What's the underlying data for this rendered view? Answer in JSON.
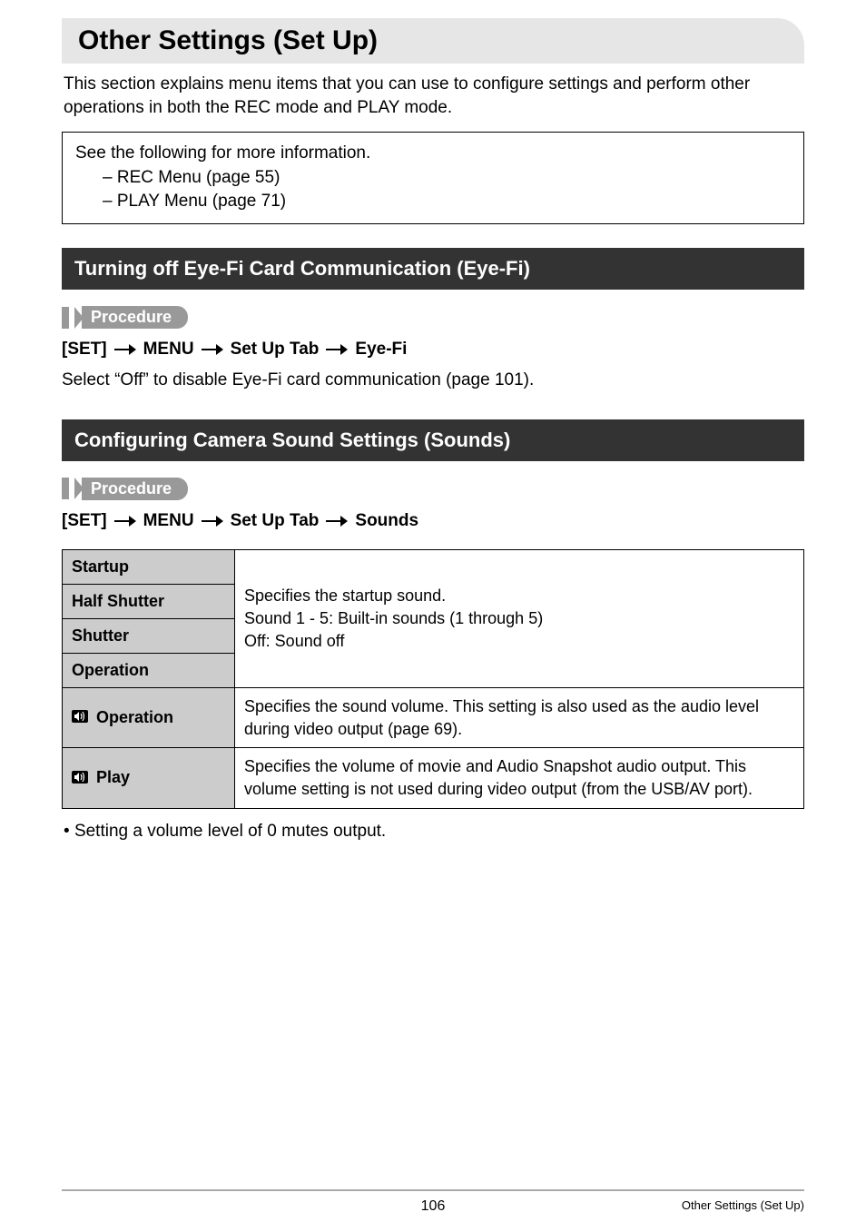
{
  "page_title": "Other Settings (Set Up)",
  "intro": "This section explains menu items that you can use to configure settings and perform other operations in both the REC mode and PLAY mode.",
  "info_box": {
    "lead": "See the following for more information.",
    "items": [
      "REC Menu (page 55)",
      "PLAY Menu (page 71)"
    ]
  },
  "sections": [
    {
      "heading": "Turning off Eye-Fi Card Communication (Eye-Fi)",
      "procedure_label": "Procedure",
      "breadcrumb": [
        "[SET]",
        "MENU",
        "Set Up Tab",
        "Eye-Fi"
      ],
      "body": "Select “Off” to disable Eye-Fi card communication (page 101)."
    },
    {
      "heading": "Configuring Camera Sound Settings (Sounds)",
      "procedure_label": "Procedure",
      "breadcrumb": [
        "[SET]",
        "MENU",
        "Set Up Tab",
        "Sounds"
      ]
    }
  ],
  "sounds_table": {
    "row_labels": {
      "startup": "Startup",
      "half_shutter": "Half Shutter",
      "shutter": "Shutter",
      "operation": "Operation",
      "vol_operation": "Operation",
      "vol_play": "Play"
    },
    "merged_desc_lines": [
      "Specifies the startup sound.",
      "Sound 1 - 5: Built-in sounds (1 through 5)",
      "Off: Sound off"
    ],
    "vol_operation_desc": "Specifies the sound volume. This setting is also used as the audio level during video output (page 69).",
    "vol_play_desc": "Specifies the volume of movie and Audio Snapshot audio output. This volume setting is not used during video output (from the USB/AV port)."
  },
  "note": "Setting a volume level of 0 mutes output.",
  "footer": {
    "page_number": "106",
    "section_label": "Other Settings (Set Up)"
  }
}
